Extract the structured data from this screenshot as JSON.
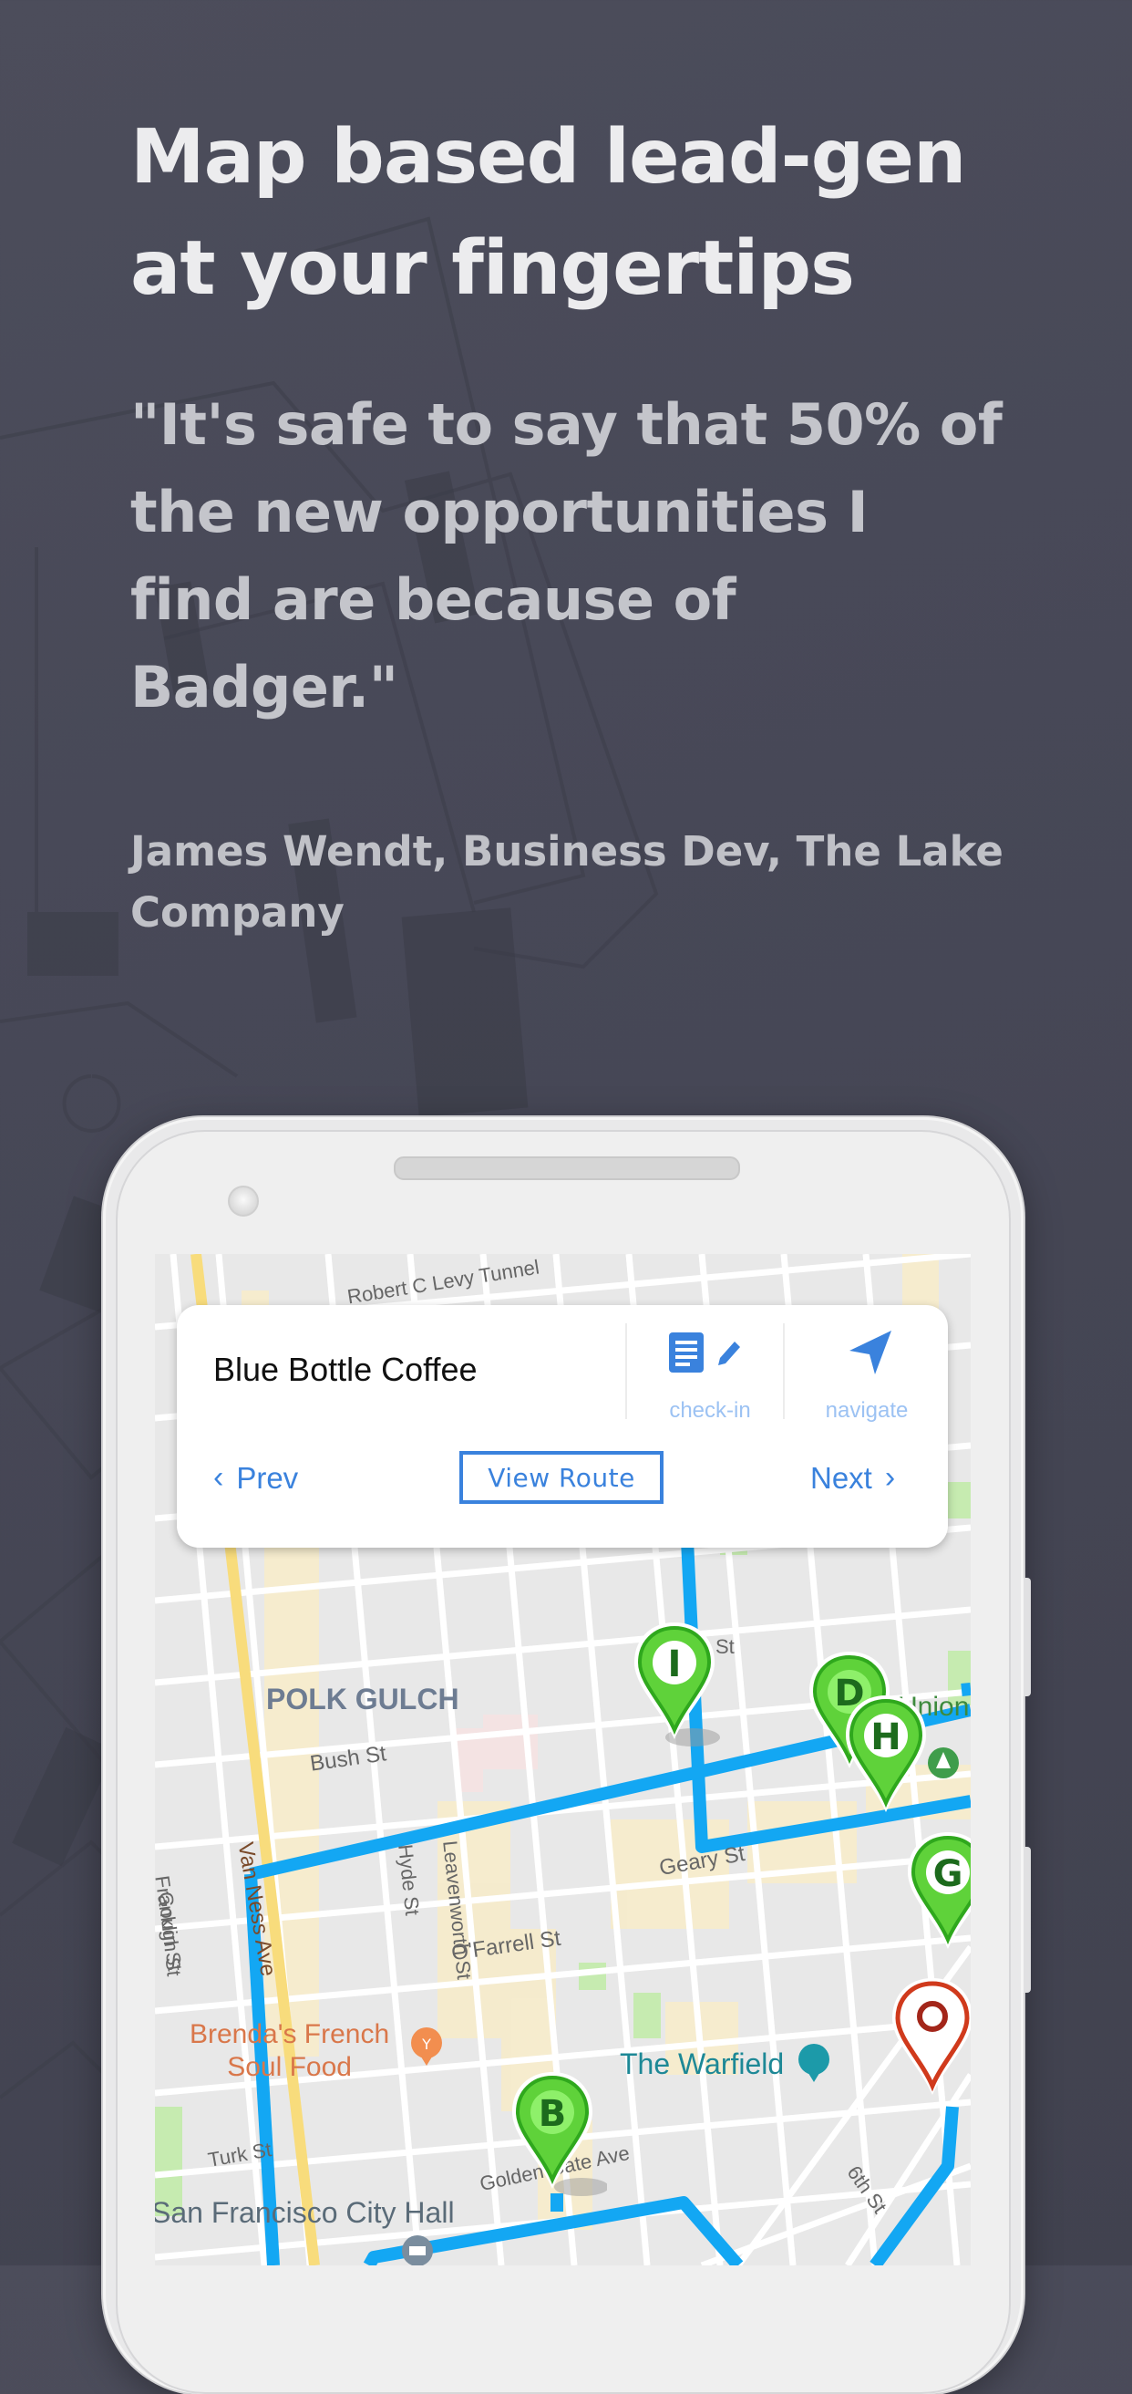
{
  "headline": {
    "line1": "Map based lead-gen",
    "line2": "at your fingertips"
  },
  "testimonial": {
    "quote_lines": [
      "\"It's safe to say that 50% of",
      "the new opportunities I",
      "find are because of",
      "Badger.\""
    ],
    "attribution_lines": [
      "James Wendt, Business Dev, The Lake",
      "Company"
    ]
  },
  "card": {
    "place_name": "Blue Bottle Coffee",
    "checkin_label": "check-in",
    "navigate_label": "navigate",
    "prev_label": "Prev",
    "view_route_label": "View Route",
    "next_label": "Next",
    "accent_color": "#3a82dd"
  },
  "map": {
    "labels": {
      "tunnel": "Robert C Levy Tunnel",
      "neighborhood": "POLK GULCH",
      "bush": "Bush St",
      "geary": "Geary St",
      "ofarrell": "O'Farrell St",
      "franklin": "Franklin St",
      "van_ness": "Van Ness Ave",
      "hyde": "Hyde St",
      "leavenworth": "Leavenworth St",
      "gough": "Gough St",
      "turk": "Turk St",
      "golden_gate": "Golden Gate Ave",
      "sixth": "6th St",
      "union_sq": "Union Sq",
      "st_fragment": "St",
      "brendas_line1": "Brenda's French",
      "brendas_line2": "Soul Food",
      "warfield": "The Warfield",
      "city_hall": "San Francisco City Hall"
    },
    "pins": [
      {
        "letter": "I",
        "type": "lead"
      },
      {
        "letter": "D",
        "type": "lead"
      },
      {
        "letter": "H",
        "type": "lead"
      },
      {
        "letter": "G",
        "type": "lead"
      },
      {
        "letter": "B",
        "type": "lead"
      },
      {
        "letter": "O",
        "type": "current"
      }
    ],
    "route_color": "#13a7f3",
    "lead_pin_color": "#5fd23a",
    "current_pin_color": "#d03a1c"
  }
}
